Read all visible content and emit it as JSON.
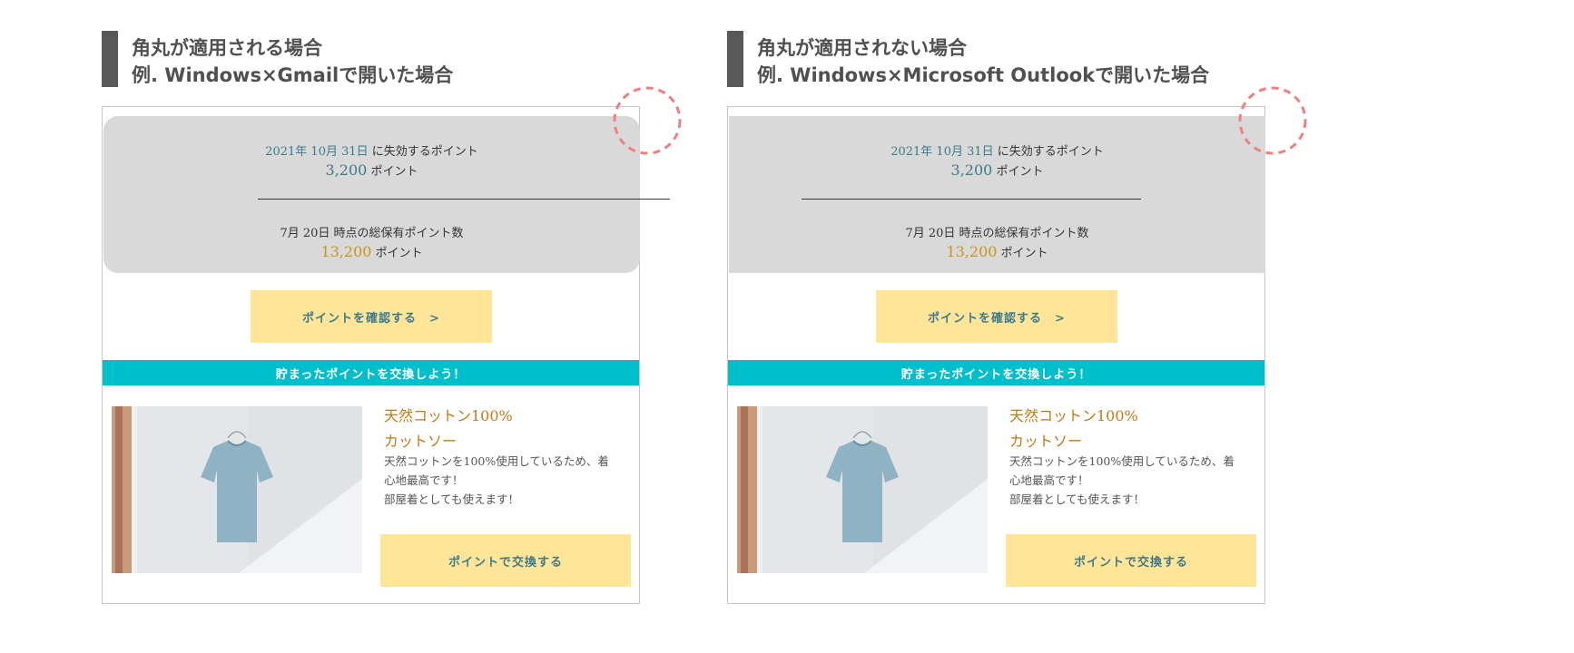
{
  "panels": {
    "left": {
      "heading_line1": "角丸が適用される場合",
      "heading_line2": "例. Windows×Gmailで開いた場合"
    },
    "right": {
      "heading_line1": "角丸が適用されない場合",
      "heading_line2": "例. Windows×Microsoft Outlookで開いた場合"
    }
  },
  "email": {
    "expiry_date": "2021年 10月 31日",
    "expiry_suffix": " に失効するポイント",
    "expiring_points": "3,200",
    "points_unit": " ポイント",
    "divider_text": "",
    "as_of_text": "7月 20日 時点の総保有ポイント数",
    "total_points": "13,200",
    "cta_label": "ポイントを確認する　>",
    "banner_text": "貯まったポイントを交換しよう！",
    "product_title_line1": "天然コットン100%",
    "product_title_line2": "カットソー",
    "product_desc_line1": "天然コットンを100%使用しているため、着",
    "product_desc_line2": "心地最高です！",
    "product_desc_line3": "部屋着としても使えます！",
    "exchange_label": "ポイントで交換する"
  },
  "colors": {
    "heading_bar": "#595959",
    "gray_box": "#d9d9d9",
    "teal_text": "#3c7a8c",
    "gold_text": "#c9961b",
    "cta_yellow": "#ffe598",
    "banner_cyan": "#00bfcc",
    "product_title": "#c07a16",
    "dashed_circle": "#f08080"
  }
}
